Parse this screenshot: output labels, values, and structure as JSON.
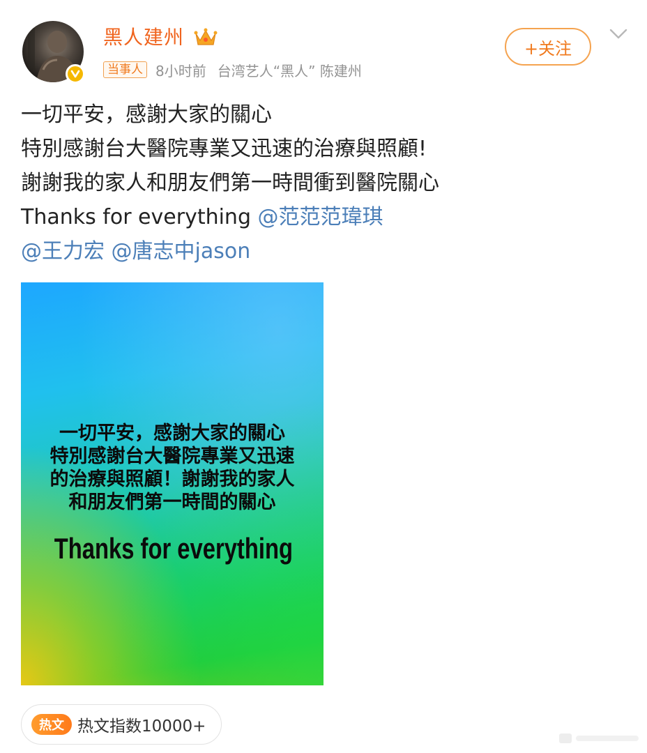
{
  "header": {
    "username": "黑人建州",
    "tag": "当事人",
    "time": "8小时前",
    "description": "台湾艺人“黑人” 陈建州",
    "follow_label": "+关注"
  },
  "post": {
    "line1": "一切平安，感謝大家的關心",
    "line2": "特別感謝台大醫院專業又迅速的治療與照顧!",
    "line3": "謝謝我的家人和朋友們第一時間衝到醫院關心",
    "line4_text": "Thanks for everything ",
    "mention1": "@范范范瑋琪",
    "mention2": "@王力宏",
    "mention3": "@唐志中jason"
  },
  "image": {
    "line1": "一切平安，感謝大家的關心",
    "line2": "特別感謝台大醫院專業又迅速",
    "line3": "的治療與照顧！謝謝我的家人",
    "line4": "和朋友們第一時間的關心",
    "thanks": "Thanks for everything"
  },
  "hot": {
    "tag": "热文",
    "text": "热文指数10000+"
  },
  "colors": {
    "username": "#f0641e",
    "mention": "#4c7fb8",
    "accent": "#f07a1e",
    "verified": "#f5b800"
  },
  "icons": {
    "crown": "crown-icon",
    "verified": "verified-icon",
    "chevron": "chevron-down-icon"
  }
}
